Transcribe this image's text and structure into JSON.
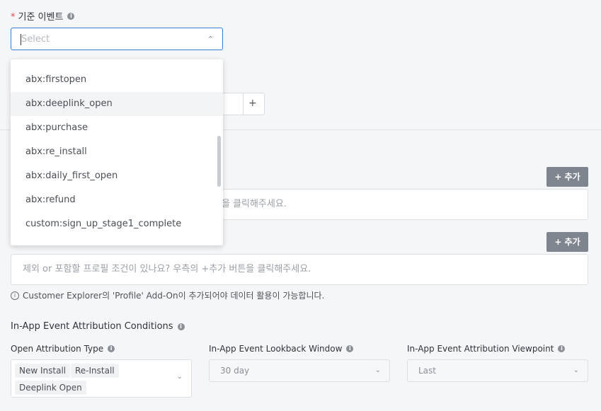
{
  "base_event": {
    "required_mark": "*",
    "label": "기준 이벤트",
    "placeholder": "Select",
    "dropdown_options": [
      "abx:firstopen",
      "abx:deeplink_open",
      "abx:purchase",
      "abx:re_install",
      "abx:daily_first_open",
      "abx:refund",
      "custom:sign_up_stage1_complete"
    ],
    "highlighted_option": "abx:deeplink_open"
  },
  "stepper": {
    "plus": "+"
  },
  "event_condition": {
    "add_label": "+ 추가",
    "placeholder_visible": "튼을 클릭해주세요."
  },
  "profile_condition": {
    "add_label": "+ 추가",
    "placeholder": "제외 or 포함할 프로필 조건이 있나요? 우측의 +추가 버튼을 클릭해주세요."
  },
  "note": "Customer Explorer의 'Profile' Add-On이 추가되어야 데이터 활용이 가능합니다.",
  "in_app": {
    "title": "In-App Event Attribution Conditions",
    "open_type_label": "Open Attribution Type",
    "open_type_tags": [
      "New Install",
      "Re-Install",
      "Deeplink Open"
    ],
    "lookback_label": "In-App Event Lookback Window",
    "lookback_value": "30 day",
    "viewpoint_label": "In-App Event Attribution Viewpoint",
    "viewpoint_value": "Last"
  }
}
